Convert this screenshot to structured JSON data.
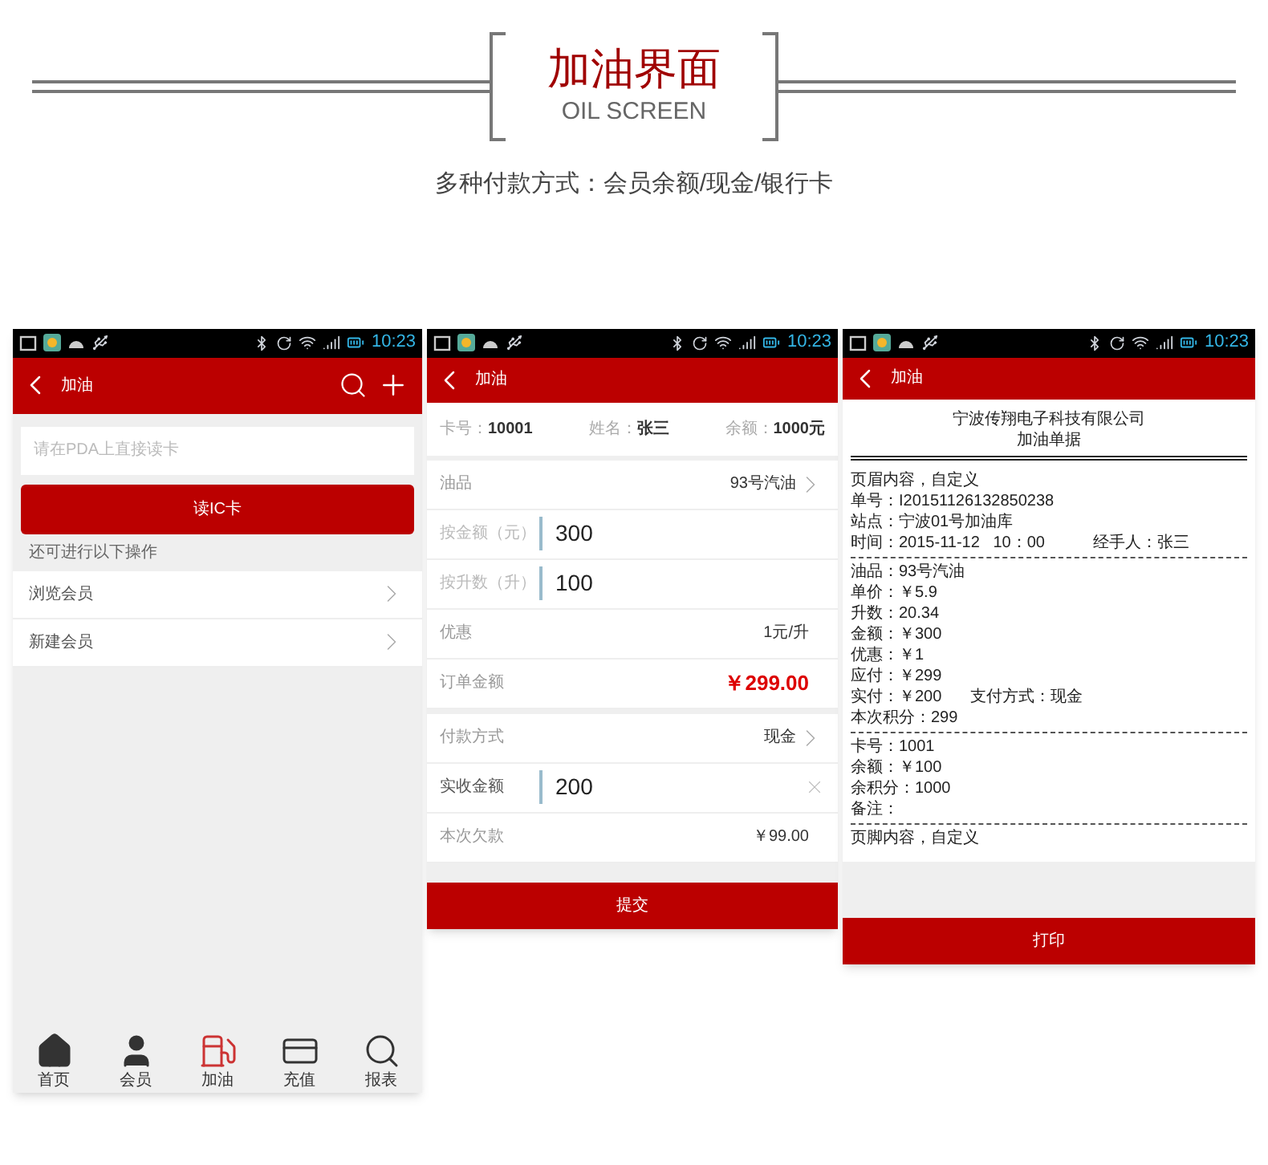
{
  "header": {
    "title": "加油界面",
    "subtitle": "OIL SCREEN",
    "caption": "多种付款方式：会员余额/现金/银行卡"
  },
  "screens": [
    {
      "kind": "card_read",
      "status_time": "10:23",
      "title": "加油",
      "placeholder": "请在PDA上直接读卡",
      "button": "读IC卡",
      "section_label": "还可进行以下操作",
      "menu": [
        "浏览会员",
        "新建会员"
      ],
      "nav": [
        "首页",
        "会员",
        "加油",
        "充值",
        "报表"
      ]
    },
    {
      "kind": "order",
      "status_time": "10:23",
      "title": "加油",
      "member": [
        {
          "label": "卡号：",
          "value": "10001"
        },
        {
          "label": "姓名：",
          "value": "张三"
        },
        {
          "label": "余额：",
          "value": "1000元"
        }
      ],
      "groups": [
        [
          {
            "kind": "select",
            "label": "油品",
            "value": "93号汽油"
          },
          {
            "kind": "input",
            "label": "按金额（元）",
            "value": "300"
          },
          {
            "kind": "input",
            "label": "按升数（升）",
            "value": "100"
          },
          {
            "kind": "text",
            "label": "优惠",
            "value": "1元/升"
          },
          {
            "kind": "total",
            "label": "订单金额",
            "value": "￥299.00"
          }
        ],
        [
          {
            "kind": "select",
            "label": "付款方式",
            "value": "现金"
          },
          {
            "kind": "clearable",
            "label": "实收金额",
            "value": "200"
          },
          {
            "kind": "text",
            "label": "本次欠款",
            "value": "￥99.00"
          }
        ]
      ],
      "button": "提交"
    },
    {
      "kind": "receipt",
      "status_time": "10:23",
      "title": "加油",
      "company": "宁波传翔电子科技有限公司",
      "doc_title": "加油单据",
      "sections": [
        [
          [
            "页眉内容，自定义"
          ],
          [
            "单号：I20151126132850238"
          ],
          [
            "站点：宁波01号加油库"
          ],
          [
            "时间：2015-11-12   10：00",
            "经手人：张三"
          ]
        ],
        [
          [
            "油品：93号汽油"
          ],
          [
            "单价：￥5.9"
          ],
          [
            "升数：20.34"
          ],
          [
            "金额：￥300"
          ],
          [
            "优惠：￥1"
          ],
          [
            "应付：￥299"
          ],
          [
            "实付：￥200",
            "支付方式：现金"
          ],
          [
            "本次积分：299"
          ]
        ],
        [
          [
            "卡号：1001"
          ],
          [
            "余额：￥100"
          ],
          [
            "余积分：1000"
          ],
          [
            "备注："
          ]
        ],
        [
          [
            "页脚内容，自定义"
          ]
        ]
      ],
      "button": "打印"
    }
  ]
}
